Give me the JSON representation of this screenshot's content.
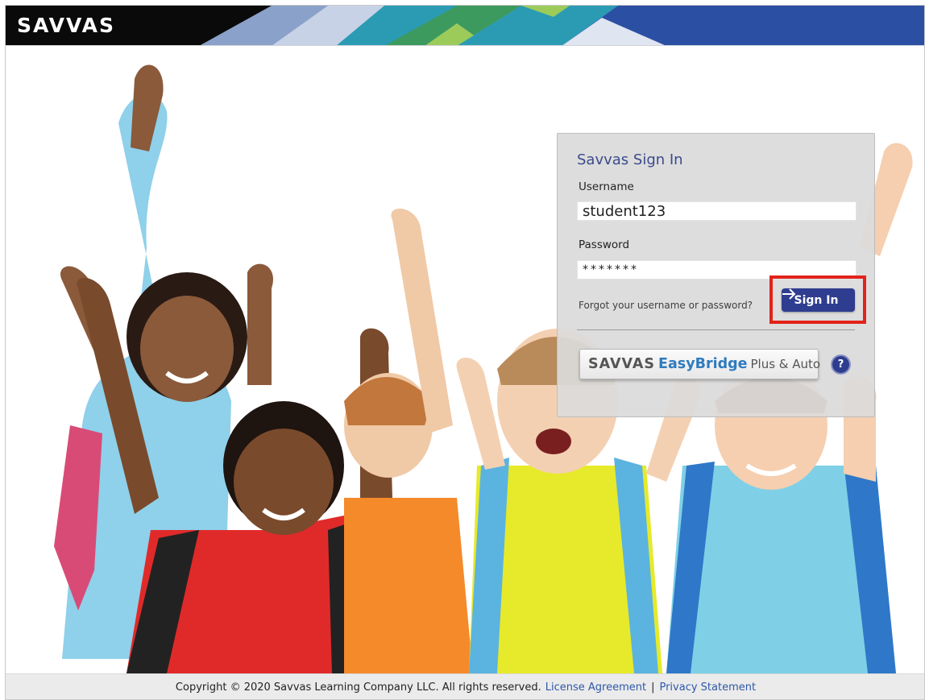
{
  "header": {
    "logo": "SAVVAS",
    "colors": {
      "bar": "#0a0a0a",
      "blue": "#2b4fa3",
      "teal": "#2b9bb4",
      "green": "#3c9a5f",
      "lime": "#9ccb5a"
    }
  },
  "hero": {
    "image": "children-cheering-with-backpacks"
  },
  "signin": {
    "title": "Savvas Sign In",
    "username_label": "Username",
    "username_value": "student123",
    "password_label": "Password",
    "password_value": "*******",
    "forgot_link": "Forgot your username or password?",
    "sign_in_button": "Sign In",
    "sign_in_icon": "arrow-right-icon",
    "easybridge": {
      "brand": "SAVVAS",
      "product": "EasyBridge",
      "suffix": "Plus & Auto"
    },
    "help_button": "?",
    "colors": {
      "title": "#3b4a8c",
      "button": "#2e3d8f",
      "highlight": "#e2231a"
    }
  },
  "footer": {
    "copyright": "Copyright © 2020 Savvas Learning Company LLC. All rights reserved.",
    "license_link": "License Agreement",
    "separator": "|",
    "privacy_link": "Privacy Statement"
  }
}
